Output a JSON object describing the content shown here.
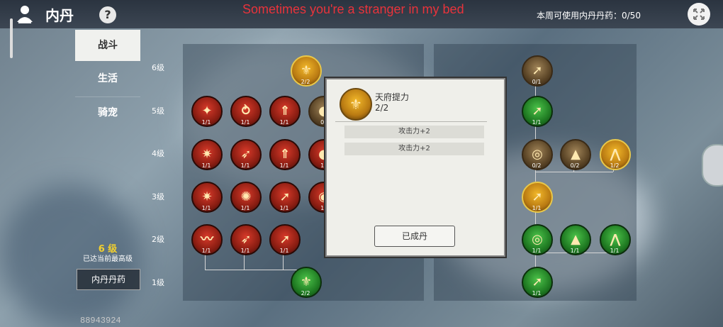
{
  "header": {
    "title": "内丹",
    "help_label": "?",
    "lyric": "Sometimes you're a stranger in my bed",
    "weekly_usage": "本周可使用内丹丹药：0/50",
    "close_icon": "close-arrows-icon"
  },
  "sidebar": {
    "tabs": [
      {
        "label": "战斗",
        "active": true
      },
      {
        "label": "生活",
        "active": false
      },
      {
        "label": "骑宠",
        "active": false
      }
    ],
    "level_value": "6 级",
    "level_note": "已达当前最高级",
    "pill_button": "内丹丹药",
    "player_id": "88943924"
  },
  "levels": [
    "6级",
    "5级",
    "4级",
    "3级",
    "2级",
    "1级"
  ],
  "tree_left": {
    "rows": [
      {
        "level": "6级",
        "nodes": [
          {
            "count": "2/2",
            "style": "gold",
            "glyph": "⚜"
          }
        ]
      },
      {
        "level": "5级",
        "nodes": [
          {
            "count": "1/1",
            "style": "red",
            "glyph": "✦"
          },
          {
            "count": "1/1",
            "style": "red",
            "glyph": "⥁"
          },
          {
            "count": "1/1",
            "style": "red",
            "glyph": "⇑"
          },
          {
            "count": "0/",
            "style": "dark",
            "glyph": "●"
          }
        ]
      },
      {
        "level": "4级",
        "nodes": [
          {
            "count": "1/1",
            "style": "red",
            "glyph": "✷"
          },
          {
            "count": "1/1",
            "style": "red",
            "glyph": "➶"
          },
          {
            "count": "1/1",
            "style": "red",
            "glyph": "⇑"
          },
          {
            "count": "1/",
            "style": "red",
            "glyph": "●"
          }
        ]
      },
      {
        "level": "3级",
        "nodes": [
          {
            "count": "1/1",
            "style": "red",
            "glyph": "✷"
          },
          {
            "count": "1/1",
            "style": "red",
            "glyph": "✺"
          },
          {
            "count": "1/1",
            "style": "red",
            "glyph": "➚"
          },
          {
            "count": "1/",
            "style": "red",
            "glyph": "◉"
          }
        ]
      },
      {
        "level": "2级",
        "nodes": [
          {
            "count": "1/1",
            "style": "red",
            "glyph": "〰"
          },
          {
            "count": "1/1",
            "style": "red",
            "glyph": "➶"
          },
          {
            "count": "1/1",
            "style": "red",
            "glyph": "➚"
          }
        ]
      },
      {
        "level": "1级",
        "nodes": [
          {
            "count": "2/2",
            "style": "green",
            "glyph": "⚜"
          }
        ]
      }
    ]
  },
  "tree_right": {
    "rows": [
      {
        "level": "6级",
        "nodes": [
          {
            "count": "0/1",
            "style": "dark",
            "glyph": "➚"
          }
        ]
      },
      {
        "level": "5级",
        "nodes": [
          {
            "count": "1/1",
            "style": "green",
            "glyph": "➚"
          }
        ]
      },
      {
        "level": "4级",
        "nodes": [
          {
            "count": "0/2",
            "style": "dark",
            "glyph": "◎"
          },
          {
            "count": "0/2",
            "style": "dark",
            "glyph": "▲"
          },
          {
            "count": "1/2",
            "style": "gold",
            "glyph": "⋀"
          }
        ]
      },
      {
        "level": "3级",
        "nodes": [
          {
            "count": "1/1",
            "style": "gold",
            "glyph": "➚"
          }
        ]
      },
      {
        "level": "2级",
        "nodes": [
          {
            "count": "1/1",
            "style": "green",
            "glyph": "◎"
          },
          {
            "count": "1/1",
            "style": "green",
            "glyph": "▲"
          },
          {
            "count": "1/1",
            "style": "green",
            "glyph": "⋀"
          }
        ]
      },
      {
        "level": "1级",
        "nodes": [
          {
            "count": "1/1",
            "style": "green",
            "glyph": "➚"
          }
        ]
      }
    ]
  },
  "popup": {
    "skill_name": "天府提力",
    "skill_count": "2/2",
    "stats": [
      "攻击力+2",
      "攻击力+2"
    ],
    "done_button": "已成丹"
  },
  "colors": {
    "lyric": "#e8333b",
    "max_level": "#f3d02e"
  }
}
